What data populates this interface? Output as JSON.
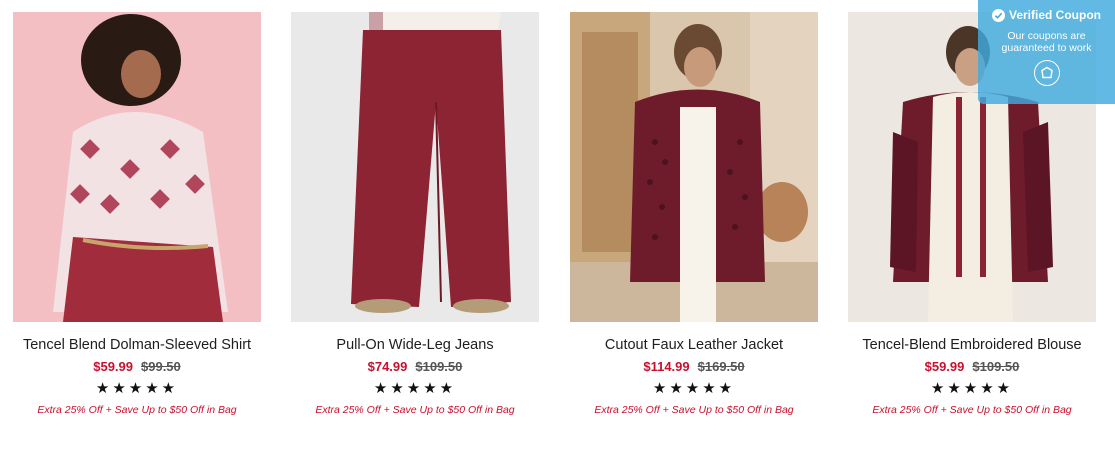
{
  "products": [
    {
      "title": "Tencel Blend Dolman-Sleeved Shirt",
      "sale_price": "$59.99",
      "original_price": "$99.50",
      "rating_stars": "★★★★★",
      "promo": "Extra 25% Off + Save Up to $50 Off in Bag"
    },
    {
      "title": "Pull-On Wide-Leg Jeans",
      "sale_price": "$74.99",
      "original_price": "$109.50",
      "rating_stars": "★★★★★",
      "promo": "Extra 25% Off + Save Up to $50 Off in Bag"
    },
    {
      "title": "Cutout Faux Leather Jacket",
      "sale_price": "$114.99",
      "original_price": "$169.50",
      "rating_stars": "★★★★★",
      "promo": "Extra 25% Off + Save Up to $50 Off in Bag"
    },
    {
      "title": "Tencel-Blend Embroidered Blouse",
      "sale_price": "$59.99",
      "original_price": "$109.50",
      "rating_stars": "★★★★★",
      "promo": "Extra 25% Off + Save Up to $50 Off in Bag"
    }
  ],
  "coupon_badge": {
    "title": "Verified Coupon",
    "subtitle": "Our coupons are guaranteed to work",
    "icon": "shield-icon"
  },
  "colors": {
    "sale_red": "#c8102e",
    "badge_blue": "#3fabde",
    "burgundy": "#8a2433"
  }
}
